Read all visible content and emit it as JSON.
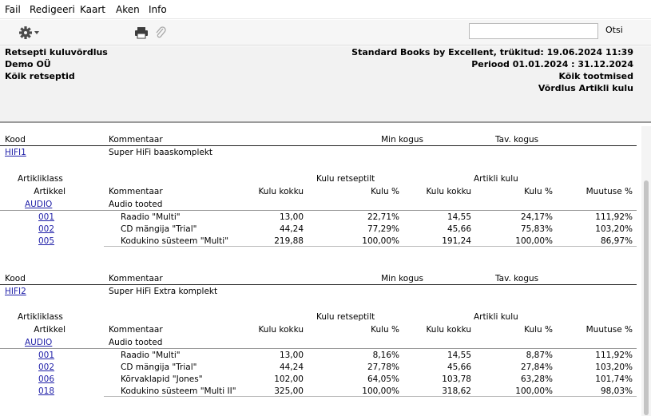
{
  "menu": [
    "Fail",
    "Redigeeri",
    "Kaart",
    "Aken",
    "Info"
  ],
  "toolbar": {
    "search_value": "",
    "search_button": "Otsi"
  },
  "header": {
    "left": [
      "Retsepti kuluvõrdlus",
      "Demo OÜ",
      "Kõik retseptid"
    ],
    "right": [
      "Standard Books by Excellent, trükitud: 19.06.2024 11:39",
      "Periood  01.01.2024 : 31.12.2024",
      "Kõik tootmised",
      "Võrdlus Artikli kulu"
    ]
  },
  "report": {
    "col_kood": "Kood",
    "col_kommentaar": "Kommentaar",
    "col_min": "Min kogus",
    "col_tav": "Tav. kogus",
    "col_artikliklass": "Artikliklass",
    "col_artikkel": "Artikkel",
    "group_retsept": "Kulu retseptilt",
    "group_artikli": "Artikli kulu",
    "col_kulu_kokku": "Kulu kokku",
    "col_kulu_pct": "Kulu %",
    "col_muutuse": "Muutuse %",
    "recipes": [
      {
        "code": "HIFI1",
        "comment": "Super HiFi baaskomplekt",
        "class_code": "AUDIO",
        "class_name": "Audio tooted",
        "rows": [
          {
            "code": "001",
            "comment": "Raadio \"Multi\"",
            "kulu1": "13,00",
            "pct1": "22,71%",
            "kulu2": "14,55",
            "pct2": "24,17%",
            "muutus": "111,92%"
          },
          {
            "code": "002",
            "comment": "CD mängija \"Trial\"",
            "kulu1": "44,24",
            "pct1": "77,29%",
            "kulu2": "45,66",
            "pct2": "75,83%",
            "muutus": "103,20%"
          },
          {
            "code": "005",
            "comment": "Kodukino süsteem \"Multi\"",
            "kulu1": "219,88",
            "pct1": "100,00%",
            "kulu2": "191,24",
            "pct2": "100,00%",
            "muutus": "86,97%"
          }
        ]
      },
      {
        "code": "HIFI2",
        "comment": "Super HiFi Extra komplekt",
        "class_code": "AUDIO",
        "class_name": "Audio tooted",
        "rows": [
          {
            "code": "001",
            "comment": "Raadio \"Multi\"",
            "kulu1": "13,00",
            "pct1": "8,16%",
            "kulu2": "14,55",
            "pct2": "8,87%",
            "muutus": "111,92%"
          },
          {
            "code": "002",
            "comment": "CD mängija \"Trial\"",
            "kulu1": "44,24",
            "pct1": "27,78%",
            "kulu2": "45,66",
            "pct2": "27,84%",
            "muutus": "103,20%"
          },
          {
            "code": "006",
            "comment": "Kõrvaklapid \"Jones\"",
            "kulu1": "102,00",
            "pct1": "64,05%",
            "kulu2": "103,78",
            "pct2": "63,28%",
            "muutus": "101,74%"
          },
          {
            "code": "018",
            "comment": "Kodukino süsteem \"Multi II\"",
            "kulu1": "325,00",
            "pct1": "100,00%",
            "kulu2": "318,62",
            "pct2": "100,00%",
            "muutus": "98,03%"
          }
        ]
      }
    ]
  }
}
